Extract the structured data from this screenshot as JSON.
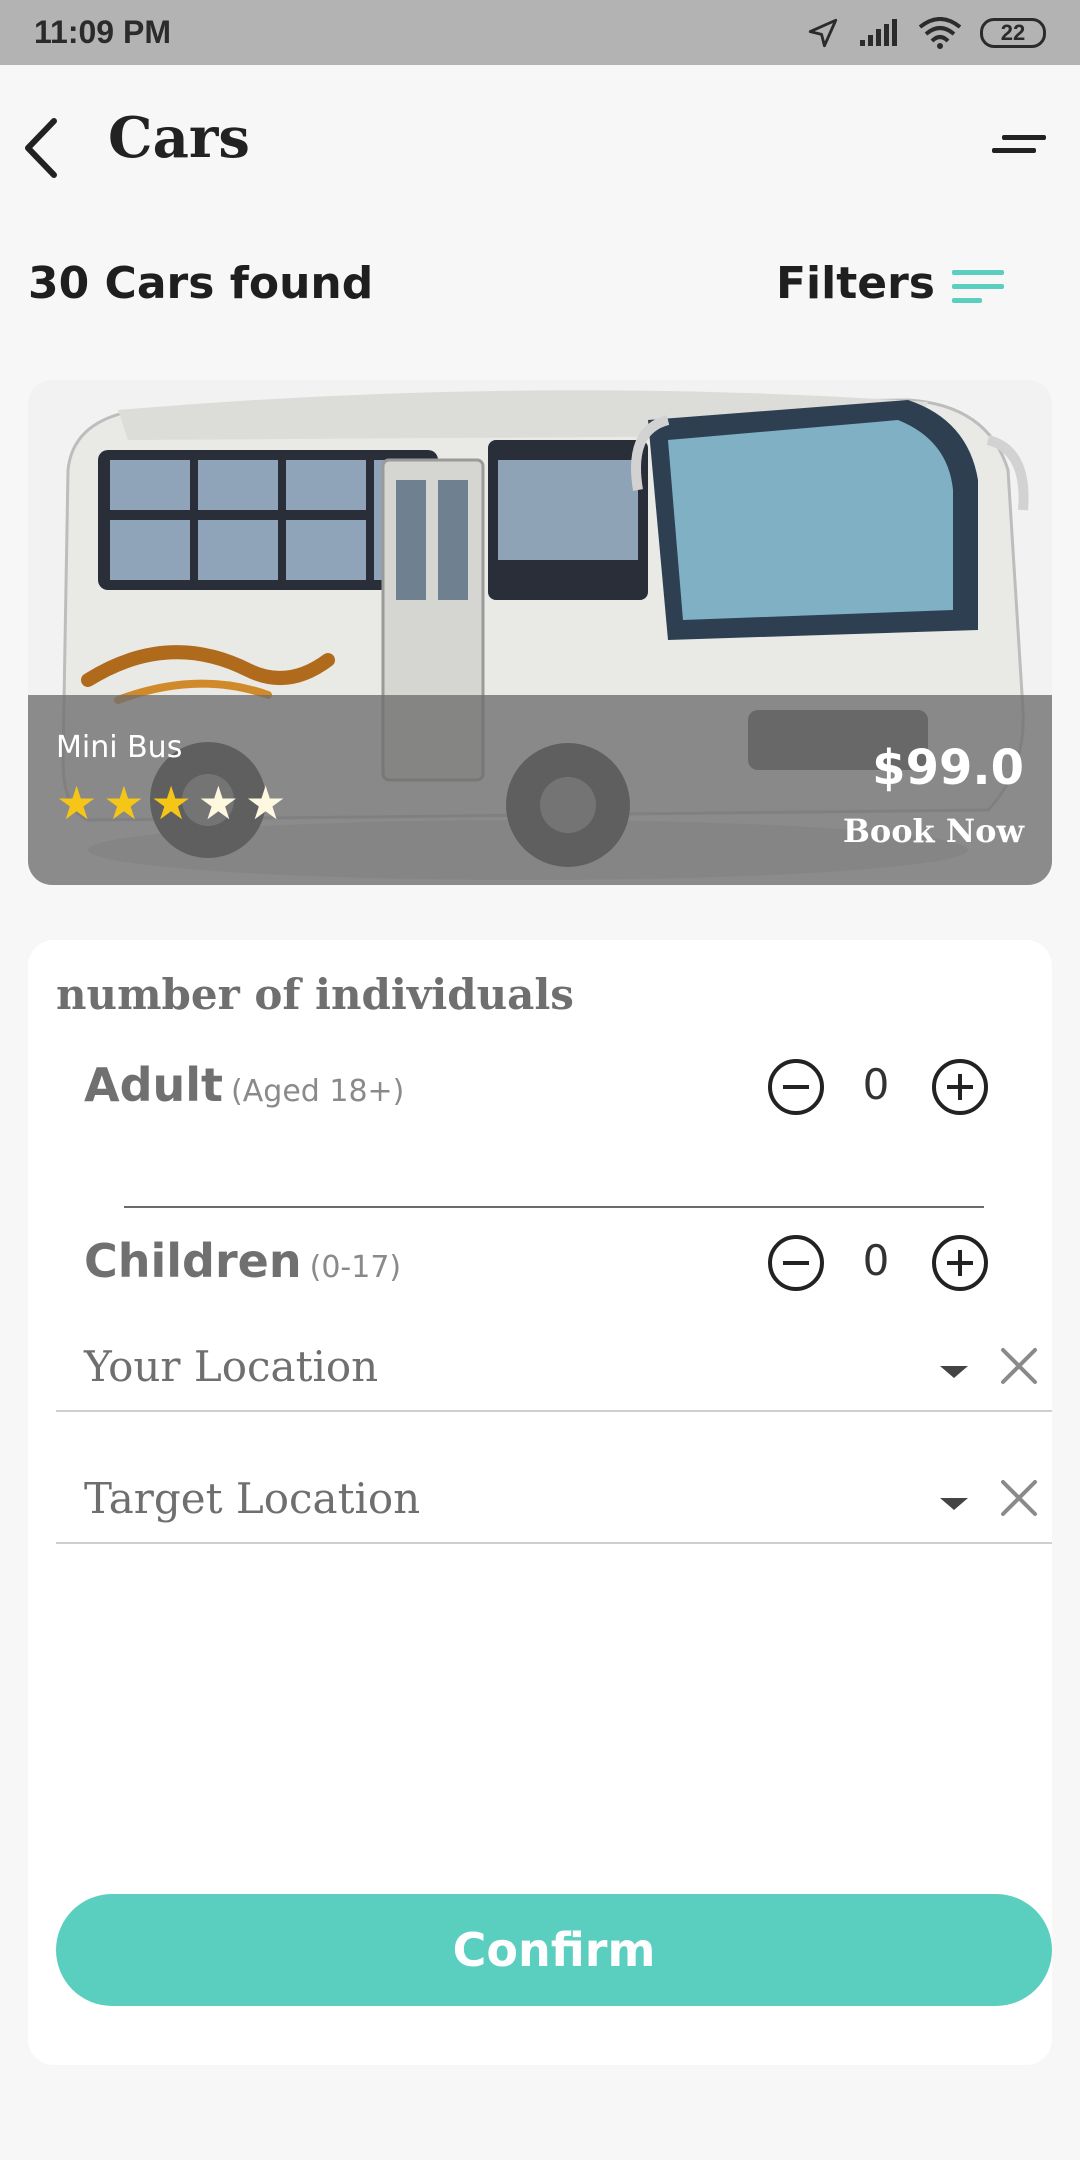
{
  "status_bar": {
    "time": "11:09 PM",
    "battery": "22"
  },
  "app_bar": {
    "title": "Cars"
  },
  "results": {
    "found_text": "30 Cars found",
    "filters_label": "Filters"
  },
  "car": {
    "name": "Mini Bus",
    "rating": 3,
    "rating_max": 5,
    "price": "$99.0",
    "book_now": "Book Now"
  },
  "form": {
    "section_title": "number of individuals",
    "adult": {
      "label": "Adult",
      "sub": "(Aged 18+)",
      "value": "0"
    },
    "children": {
      "label": "Children",
      "sub": "(0-17)",
      "value": "0"
    },
    "your_location": {
      "placeholder": "Your Location"
    },
    "target_location": {
      "placeholder": "Target Location"
    },
    "confirm_label": "Confirm"
  },
  "colors": {
    "accent": "#5acfbf",
    "star_filled": "#f5c518",
    "star_empty": "#fff8e1",
    "statusbar": "#b3b3b3"
  },
  "icons": {
    "back": "back-arrow-icon",
    "menu": "menu-icon",
    "filters": "filter-lines-icon",
    "minus": "minus-circle-icon",
    "plus": "plus-circle-icon",
    "dropdown": "dropdown-caret-icon",
    "clear": "close-icon"
  }
}
